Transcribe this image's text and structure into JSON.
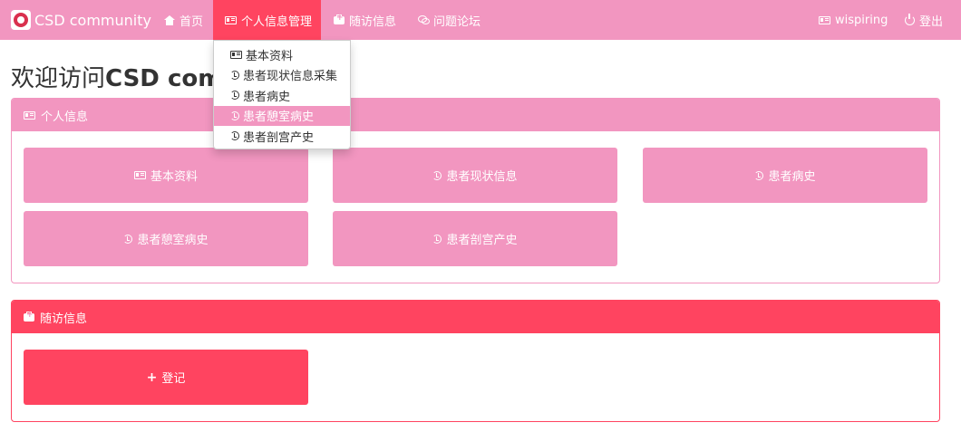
{
  "brand": {
    "title": "CSD community"
  },
  "nav": {
    "home": "首页",
    "personal_info_mgmt": "个人信息管理",
    "followup": "随访信息",
    "forum": "问题论坛",
    "user": "wispiring",
    "logout": "登出"
  },
  "dropdown": {
    "items": [
      "基本资料",
      "患者现状信息采集",
      "患者病史",
      "患者憩室病史",
      "患者剖宫产史"
    ],
    "hovered_index": 3
  },
  "page": {
    "title_prefix": "欢迎访问",
    "title_bold": "CSD comm"
  },
  "panel_personal": {
    "heading": "个人信息",
    "tiles": [
      "基本资料",
      "患者现状信息",
      "患者病史",
      "患者憩室病史",
      "患者剖宫产史"
    ]
  },
  "panel_followup": {
    "heading": "随访信息",
    "register_button": "登记"
  },
  "colors": {
    "primary_pink": "#f296c0",
    "accent_red": "#ff4460"
  },
  "icons": {
    "home": "home-icon",
    "card": "id-card-icon",
    "kit": "medkit-icon",
    "chat": "comments-icon",
    "history": "history-icon",
    "power": "power-icon",
    "plus": "plus-icon"
  }
}
